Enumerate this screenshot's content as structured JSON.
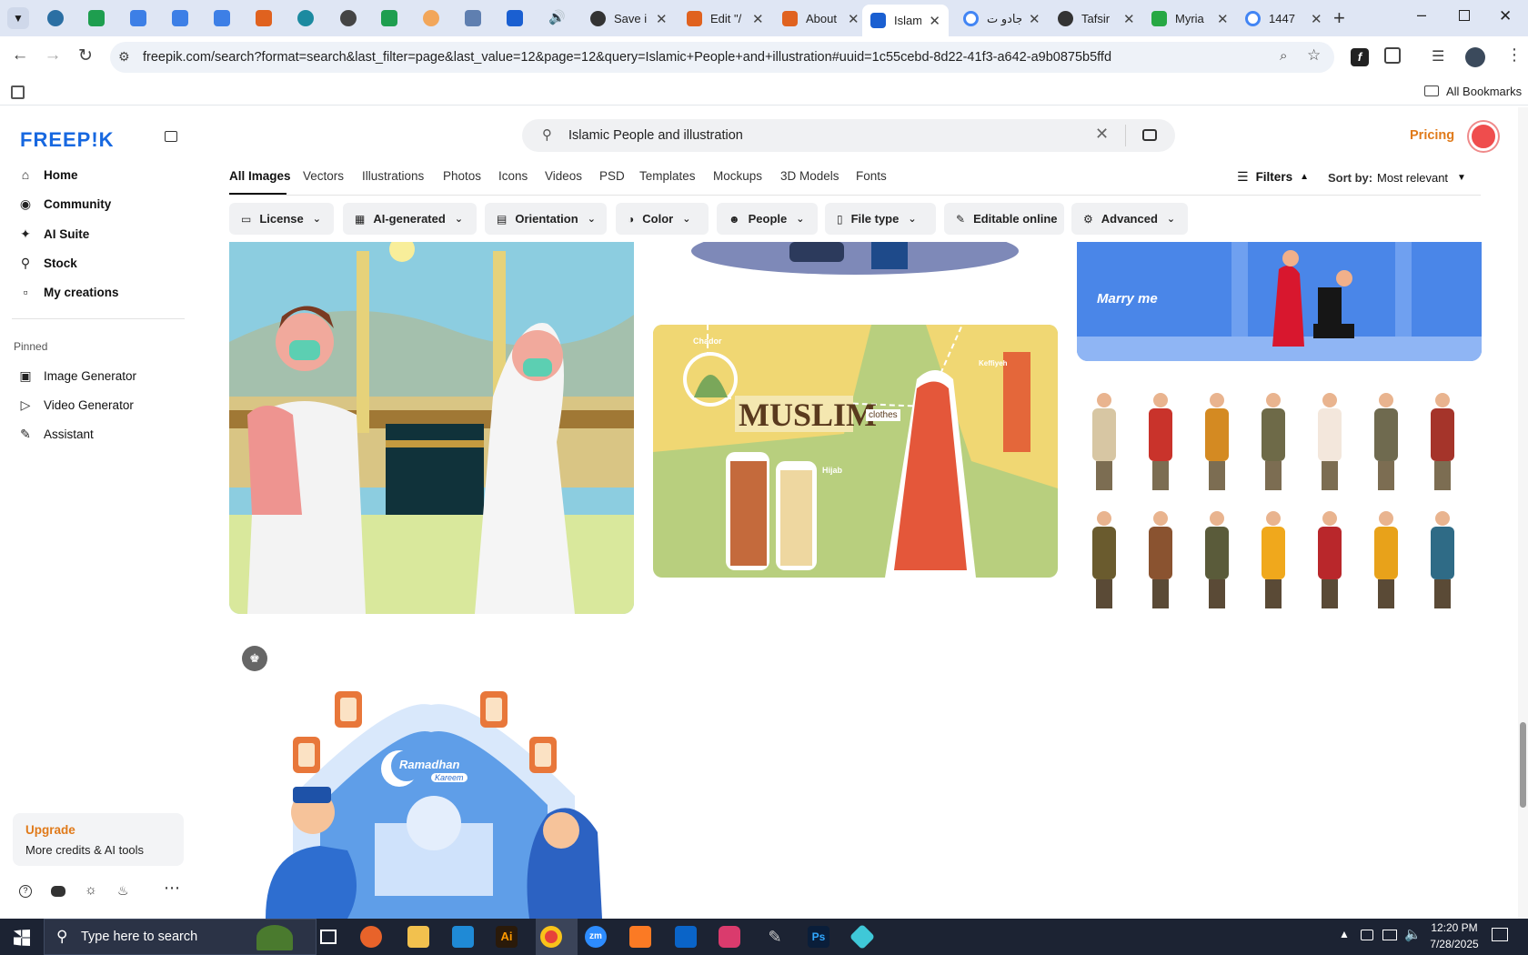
{
  "browser": {
    "tabs": [
      {
        "title": "Save i",
        "favicon": "openai-icon",
        "color": "#333333"
      },
      {
        "title": "Edit \"/",
        "favicon": "orange-grid-icon",
        "color": "#e0621f"
      },
      {
        "title": "About",
        "favicon": "orange-grid-icon",
        "color": "#e0621f"
      },
      {
        "title": "Islami",
        "favicon": "freepik-doc-icon",
        "color": "#1a5fd1",
        "active": true
      },
      {
        "title": "جادو ت",
        "favicon": "google-icon",
        "color": "#4285f4"
      },
      {
        "title": "Tafsir",
        "favicon": "dark-circle-icon",
        "color": "#333333"
      },
      {
        "title": "Myria",
        "favicon": "green-leaf-icon",
        "color": "#27a844"
      },
      {
        "title": "1447",
        "favicon": "google-icon",
        "color": "#4285f4"
      }
    ],
    "url": "freepik.com/search?format=search&last_filter=page&last_value=12&page=12&query=Islamic+People+and+illustration#uuid=1c55cebd-8d22-41f3-a642-a9b0875b5ffd",
    "bookmarks_label": "All Bookmarks"
  },
  "sidebar": {
    "logo": "FREEP!K",
    "nav": [
      {
        "label": "Home",
        "icon": "home-icon"
      },
      {
        "label": "Community",
        "icon": "globe-icon"
      },
      {
        "label": "AI Suite",
        "icon": "sparkle-icon"
      },
      {
        "label": "Stock",
        "icon": "search-icon"
      },
      {
        "label": "My creations",
        "icon": "folder-icon"
      }
    ],
    "pinned_label": "Pinned",
    "pinned": [
      {
        "label": "Image Generator",
        "icon": "image-icon"
      },
      {
        "label": "Video Generator",
        "icon": "video-icon"
      },
      {
        "label": "Assistant",
        "icon": "chat-icon"
      }
    ],
    "upgrade": {
      "title": "Upgrade",
      "subtitle": "More credits & AI tools"
    }
  },
  "search": {
    "query": "Islamic People and illustration"
  },
  "header": {
    "pricing": "Pricing"
  },
  "categories": [
    "All Images",
    "Vectors",
    "Illustrations",
    "Photos",
    "Icons",
    "Videos",
    "PSD",
    "Templates",
    "Mockups",
    "3D Models",
    "Fonts"
  ],
  "filters": {
    "label": "Filters",
    "sort_label": "Sort by:",
    "sort_value": "Most relevant"
  },
  "chips": [
    "License",
    "AI-generated",
    "Orientation",
    "Color",
    "People",
    "File type",
    "Editable online",
    "Advanced"
  ],
  "images": {
    "muslim_title": "MUSLIM",
    "muslim_clothes": "clothes",
    "muslim_chador": "Chador",
    "muslim_hijab": "Hijab",
    "muslim_keffiyeh": "Keffiyeh",
    "marry_me": "Marry me",
    "ramadan_line1": "Ramadhan",
    "ramadan_line2": "Kareem"
  },
  "taskbar": {
    "search_placeholder": "Type here to search",
    "time": "12:20 PM",
    "date": "7/28/2025"
  }
}
